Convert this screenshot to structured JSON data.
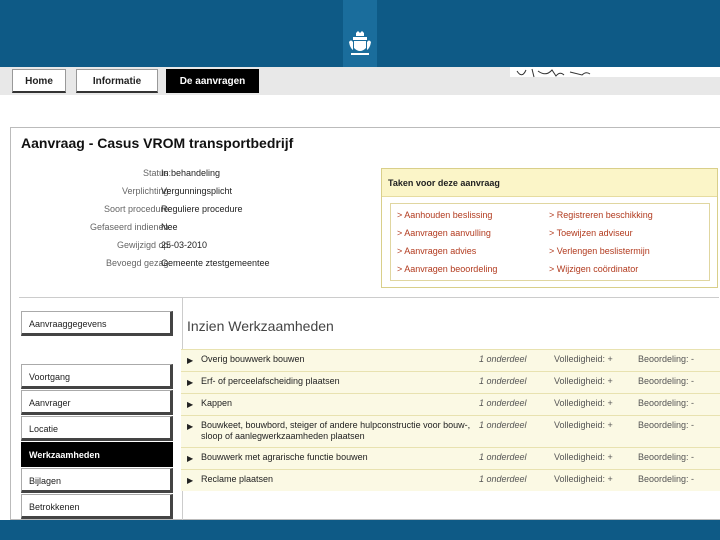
{
  "nav": {
    "tabs": [
      {
        "label": "Home"
      },
      {
        "label": "Informatie"
      },
      {
        "label": "De aanvragen"
      }
    ]
  },
  "page": {
    "title": "Aanvraag - Casus VROM transportbedrijf"
  },
  "details": [
    {
      "label": "Status:",
      "value": "In behandeling"
    },
    {
      "label": "Verplichting:",
      "value": "Vergunningsplicht"
    },
    {
      "label": "Soort procedure:",
      "value": "Reguliere procedure"
    },
    {
      "label": "Gefaseerd indienen:",
      "value": "Nee"
    },
    {
      "label": "Gewijzigd op:",
      "value": "25-03-2010"
    },
    {
      "label": "Bevoegd gezag:",
      "value": "Gemeente ztestgemeentee"
    }
  ],
  "tasks": {
    "title": "Taken voor deze aanvraag",
    "left": [
      "> Aanhouden beslissing",
      "> Aanvragen aanvulling",
      "> Aanvragen advies",
      "> Aanvragen beoordeling"
    ],
    "right": [
      "> Registreren beschikking",
      "> Toewijzen adviseur",
      "> Verlengen beslistermijn",
      "> Wijzigen coördinator"
    ]
  },
  "sidebar": [
    {
      "label": "Aanvraaggegevens"
    },
    {
      "label": "Voortgang"
    },
    {
      "label": "Aanvrager"
    },
    {
      "label": "Locatie"
    },
    {
      "label": "Werkzaamheden"
    },
    {
      "label": "Bijlagen"
    },
    {
      "label": "Betrokkenen"
    }
  ],
  "werkzaamheden": {
    "title": "Inzien Werkzaamheden",
    "rows": [
      {
        "name": "Overig bouwwerk bouwen",
        "count": "1 onderdeel",
        "volledigheid": "Volledigheid: +",
        "beoordeling": "Beoordeling: -"
      },
      {
        "name": "Erf- of perceelafscheiding plaatsen",
        "count": "1 onderdeel",
        "volledigheid": "Volledigheid: +",
        "beoordeling": "Beoordeling: -"
      },
      {
        "name": "Kappen",
        "count": "1 onderdeel",
        "volledigheid": "Volledigheid: +",
        "beoordeling": "Beoordeling: -"
      },
      {
        "name": "Bouwkeet, bouwbord, steiger of andere hulpconstructie voor bouw-, sloop of aanlegwerkzaamheden plaatsen",
        "count": "1 onderdeel",
        "volledigheid": "Volledigheid: +",
        "beoordeling": "Beoordeling: -"
      },
      {
        "name": "Bouwwerk met agrarische functie bouwen",
        "count": "1 onderdeel",
        "volledigheid": "Volledigheid: +",
        "beoordeling": "Beoordeling: -"
      },
      {
        "name": "Reclame plaatsen",
        "count": "1 onderdeel",
        "volledigheid": "Volledigheid: +",
        "beoordeling": "Beoordeling: -"
      }
    ]
  },
  "icons": {
    "logo": "royal-coat-of-arms-icon",
    "row_toggle": "triangle-right-icon"
  },
  "colors": {
    "brand_blue": "#0e5a86",
    "task_link": "#b23b1f",
    "task_header": "#fbf5c8"
  }
}
